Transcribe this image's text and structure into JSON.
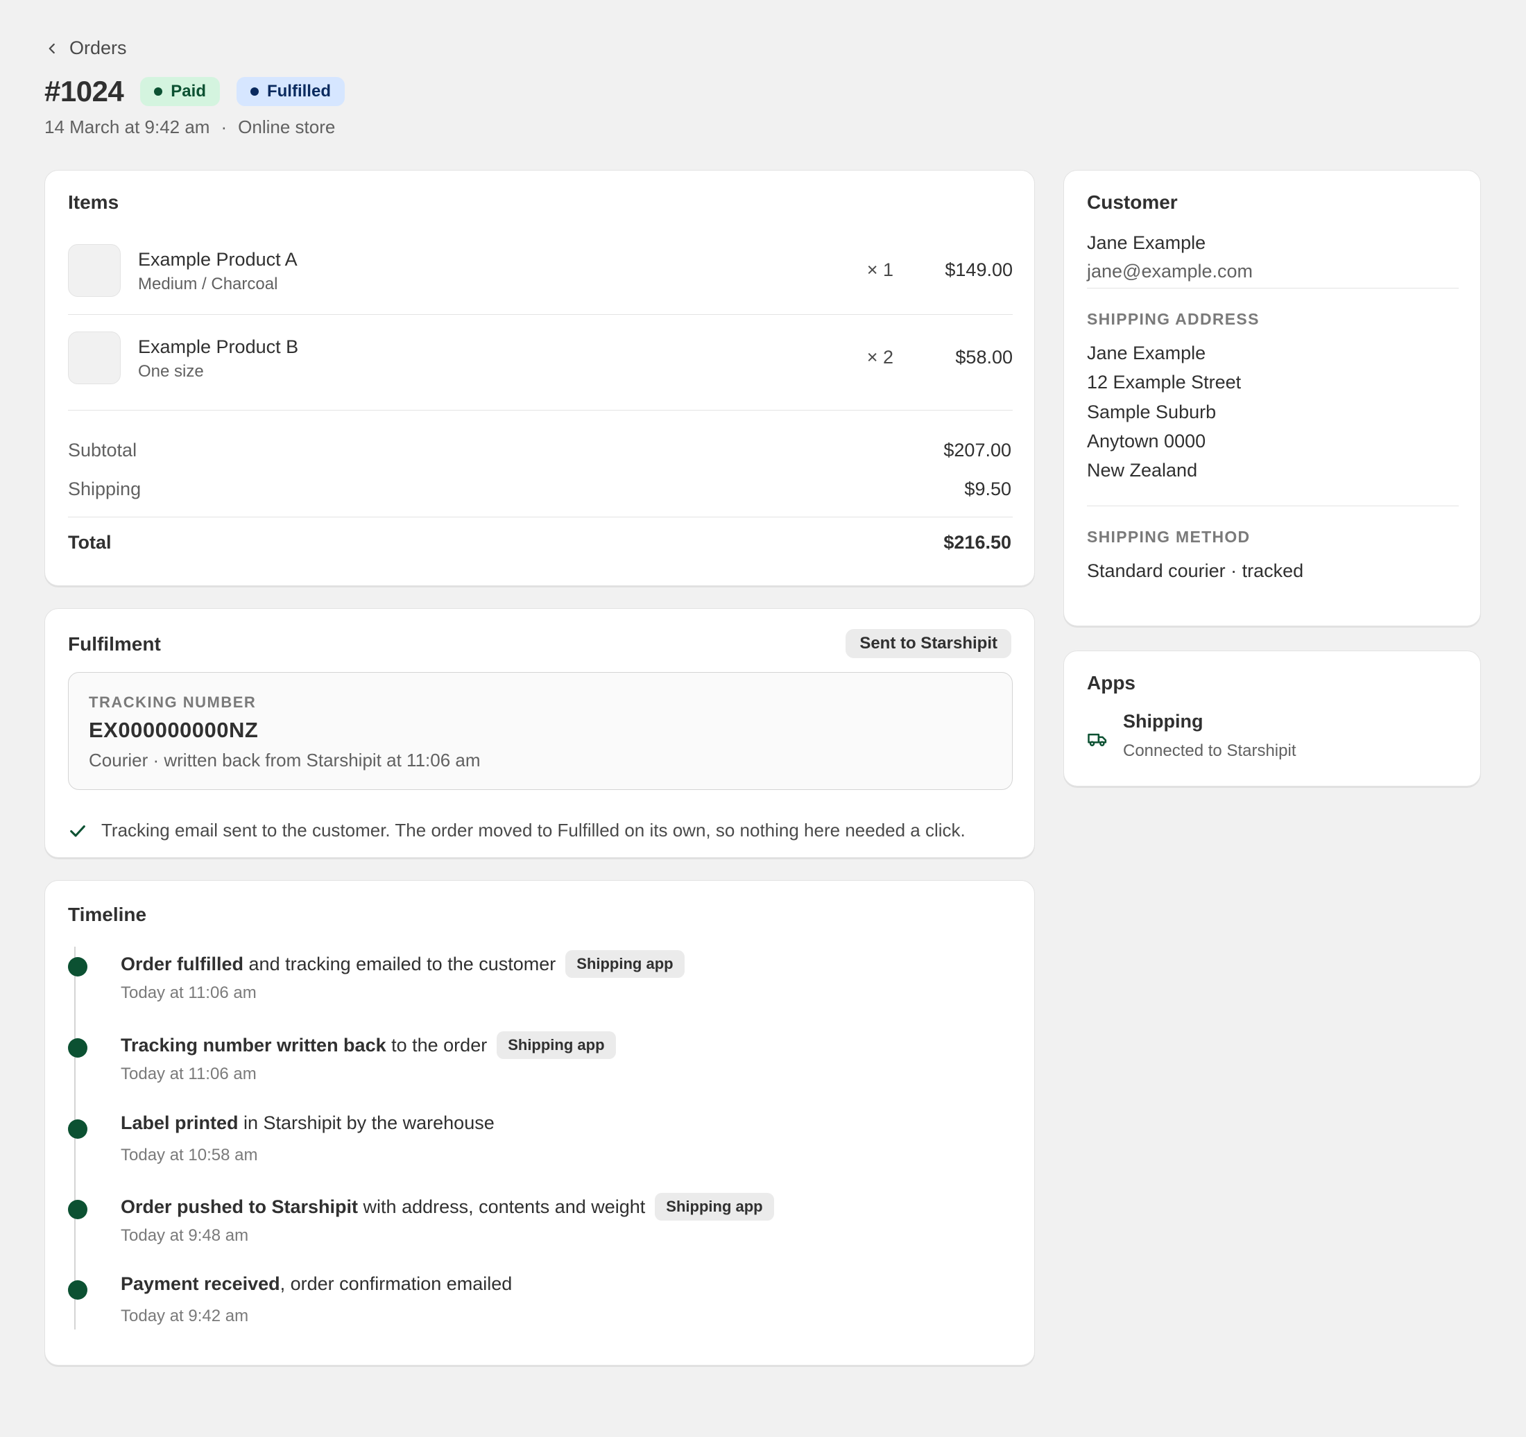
{
  "header": {
    "back_label": "Orders",
    "order_id": "#1024",
    "badges": [
      {
        "label": "Paid",
        "color": "#0c5132",
        "bg": "#d4f4df"
      },
      {
        "label": "Fulfilled",
        "color": "#0a2a5e",
        "bg": "#d6e6ff"
      }
    ],
    "date": "14 March at 9:42 am",
    "separator": "·",
    "channel": "Online store"
  },
  "items_card": {
    "title": "Items",
    "items": [
      {
        "name": "Example Product A",
        "variant": "Medium / Charcoal",
        "qty": "× 1",
        "price": "$149.00"
      },
      {
        "name": "Example Product B",
        "variant": "One size",
        "qty": "× 2",
        "price": "$58.00"
      }
    ],
    "subtotal_label": "Subtotal",
    "subtotal_value": "$207.00",
    "shipping_label": "Shipping",
    "shipping_value": "$9.50",
    "total_label": "Total",
    "total_value": "$216.50"
  },
  "fulfilment": {
    "title": "Fulfilment",
    "status_pill": "Sent to Starshipit",
    "tracking_label": "TRACKING NUMBER",
    "tracking_number": "EX000000000NZ",
    "tracking_note": "Courier · written back from Starshipit at 11:06 am",
    "message": "Tracking email sent to the customer. The order moved to Fulfilled on its own, so nothing here needed a click."
  },
  "timeline": {
    "title": "Timeline",
    "events": [
      {
        "bold": "Order fulfilled",
        "rest": " and tracking emailed to the customer",
        "tag": "Shipping app",
        "time": "Today at 11:06 am"
      },
      {
        "bold": "Tracking number written back",
        "rest": " to the order",
        "tag": "Shipping app",
        "time": "Today at 11:06 am"
      },
      {
        "bold": "Label printed",
        "rest": " in Starshipit by the warehouse",
        "tag": "",
        "time": "Today at 10:58 am"
      },
      {
        "bold": "Order pushed to Starshipit",
        "rest": " with address, contents and weight",
        "tag": "Shipping app",
        "time": "Today at 9:48 am"
      },
      {
        "bold": "Payment received",
        "rest": ", order confirmation emailed",
        "tag": "",
        "time": "Today at 9:42 am"
      }
    ]
  },
  "customer": {
    "title": "Customer",
    "name": "Jane Example",
    "email": "jane@example.com",
    "shipping_address_label": "SHIPPING ADDRESS",
    "address_lines": [
      "Jane Example",
      "12 Example Street",
      "Sample Suburb",
      "Anytown 0000",
      "New Zealand"
    ],
    "shipping_method_label": "SHIPPING METHOD",
    "shipping_method": "Standard courier · tracked"
  },
  "apps": {
    "title": "Apps",
    "app_name": "Shipping",
    "app_status": "Connected to Starshipit",
    "icon": "truck-icon"
  },
  "colors": {
    "accent_green": "#0c5132",
    "background": "#f1f1f1",
    "card": "#ffffff"
  }
}
